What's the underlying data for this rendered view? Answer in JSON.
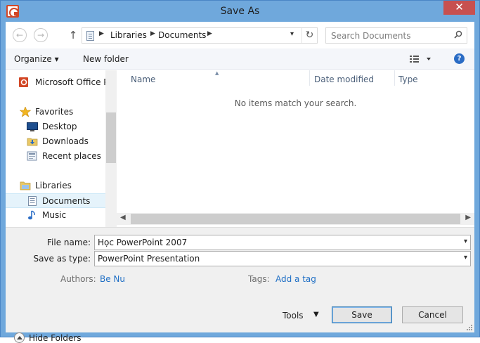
{
  "window": {
    "title": "Save As",
    "close_glyph": "✕"
  },
  "nav": {
    "back_glyph": "←",
    "forward_glyph": "→",
    "up_glyph": "↑",
    "breadcrumbs": [
      "Libraries",
      "Documents"
    ],
    "refresh_glyph": "↻",
    "search_placeholder": "Search Documents"
  },
  "toolbar": {
    "organize": "Organize ▾",
    "new_folder": "New folder",
    "help": "?"
  },
  "sidebar": {
    "items": [
      {
        "label": "Microsoft Office Po",
        "icon": "office-icon"
      },
      {
        "label": "Favorites",
        "icon": "star-icon"
      },
      {
        "label": "Desktop",
        "icon": "desktop-icon"
      },
      {
        "label": "Downloads",
        "icon": "downloads-icon"
      },
      {
        "label": "Recent places",
        "icon": "recent-places-icon"
      },
      {
        "label": "Libraries",
        "icon": "libraries-icon"
      },
      {
        "label": "Documents",
        "icon": "documents-icon",
        "selected": true
      },
      {
        "label": "Music",
        "icon": "music-icon"
      }
    ]
  },
  "filelist": {
    "columns": [
      "Name",
      "Date modified",
      "Type"
    ],
    "empty_message": "No items match your search."
  },
  "form": {
    "file_name_label": "File name:",
    "file_name_value": "Học PowerPoint 2007",
    "save_type_label": "Save as type:",
    "save_type_value": "PowerPoint Presentation",
    "authors_label": "Authors:",
    "authors_value": "Be Nu",
    "tags_label": "Tags:",
    "tags_value": "Add a tag"
  },
  "footer": {
    "hide_folders": "Hide Folders",
    "tools": "Tools",
    "save": "Save",
    "cancel": "Cancel"
  },
  "colors": {
    "titlebar": "#6fa8dc",
    "close": "#c75050",
    "accent": "#2a6cc5",
    "link": "#1f6fc5"
  }
}
